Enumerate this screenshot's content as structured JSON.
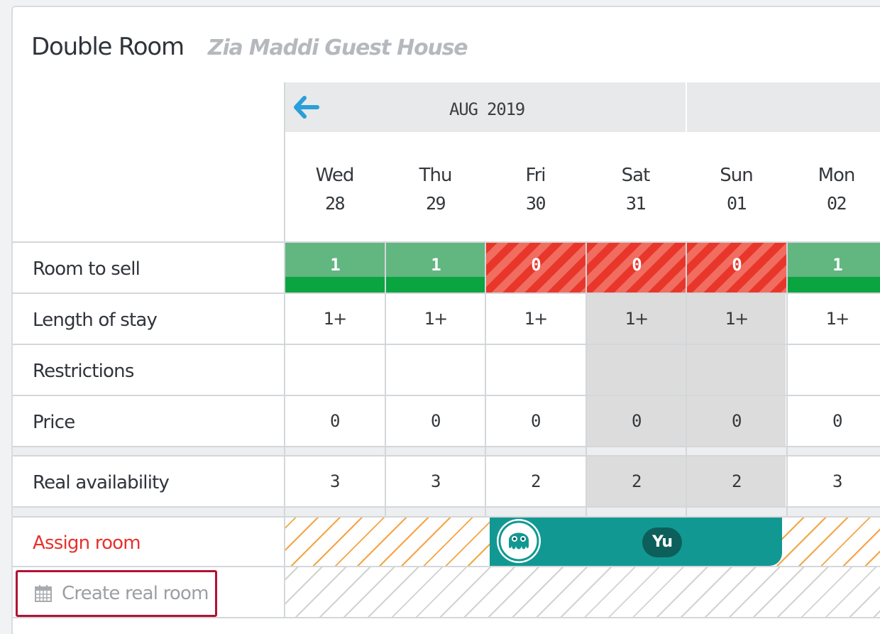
{
  "header": {
    "room_title": "Double Room",
    "property_name": "Zia Maddi Guest House"
  },
  "calendar": {
    "month_label": "AUG 2019",
    "prev_icon": "arrow-left-icon",
    "days": [
      {
        "dow": "Wed",
        "date": "28",
        "weekend": false
      },
      {
        "dow": "Thu",
        "date": "29",
        "weekend": false
      },
      {
        "dow": "Fri",
        "date": "30",
        "weekend": false
      },
      {
        "dow": "Sat",
        "date": "31",
        "weekend": true
      },
      {
        "dow": "Sun",
        "date": "01",
        "weekend": true
      },
      {
        "dow": "Mon",
        "date": "02",
        "weekend": false
      }
    ]
  },
  "rows": {
    "room_to_sell": {
      "label": "Room to sell",
      "values": [
        "1",
        "1",
        "0",
        "0",
        "0",
        "1"
      ],
      "status": [
        "open",
        "open",
        "closed",
        "closed",
        "closed",
        "open"
      ]
    },
    "length_of_stay": {
      "label": "Length of stay",
      "values": [
        "1+",
        "1+",
        "1+",
        "1+",
        "1+",
        "1+"
      ]
    },
    "restrictions": {
      "label": "Restrictions",
      "values": [
        "",
        "",
        "",
        "",
        "",
        ""
      ]
    },
    "price": {
      "label": "Price",
      "values": [
        "0",
        "0",
        "0",
        "0",
        "0",
        "0"
      ]
    },
    "real_availability": {
      "label": "Real availability",
      "values": [
        "3",
        "3",
        "2",
        "2",
        "2",
        "3"
      ]
    },
    "assign_room": {
      "label": "Assign room"
    },
    "create_real_room": {
      "label": "Create real room",
      "icon": "calendar-icon"
    }
  },
  "booking": {
    "guest_initials": "Yu",
    "avatar_icon": "octopus-avatar-icon"
  },
  "colors": {
    "available_green": "#0aa541",
    "closed_red": "#e9362b",
    "booking_teal": "#129892",
    "assign_red": "#e5322d",
    "highlight_border": "#b11233",
    "arrow_blue": "#2a9fd8"
  }
}
